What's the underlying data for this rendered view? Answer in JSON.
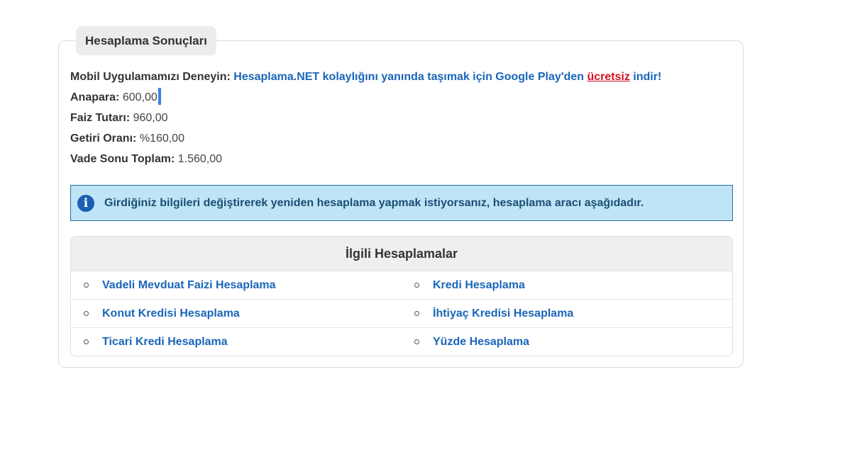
{
  "results": {
    "legend": "Hesaplama Sonuçları",
    "promo": {
      "prefix": "Mobil Uygulamamızı Deneyin:",
      "link_text": "Hesaplama.NET kolaylığını yanında taşımak için Google Play'den",
      "free_text": "ücretsiz",
      "suffix": "indir!"
    },
    "rows": [
      {
        "label": "Anapara:",
        "value": "600,00"
      },
      {
        "label": "Faiz Tutarı:",
        "value": "960,00"
      },
      {
        "label": "Getiri Oranı:",
        "value": "%160,00"
      },
      {
        "label": "Vade Sonu Toplam:",
        "value": "1.560,00"
      }
    ]
  },
  "info": {
    "icon": "info-circle-icon",
    "text": "Girdiğiniz bilgileri değiştirerek yeniden hesaplama yapmak istiyorsanız, hesaplama aracı aşağıdadır."
  },
  "related": {
    "title": "İlgili Hesaplamalar",
    "items": [
      "Vadeli Mevduat Faizi Hesaplama",
      "Kredi Hesaplama",
      "Konut Kredisi Hesaplama",
      "İhtiyaç Kredisi Hesaplama",
      "Ticari Kredi Hesaplama",
      "Yüzde Hesaplama"
    ]
  },
  "colors": {
    "link": "#1a66b8",
    "free_link": "#d2121f",
    "info_bg": "#bfe4f6",
    "info_border": "#2a6e96"
  }
}
